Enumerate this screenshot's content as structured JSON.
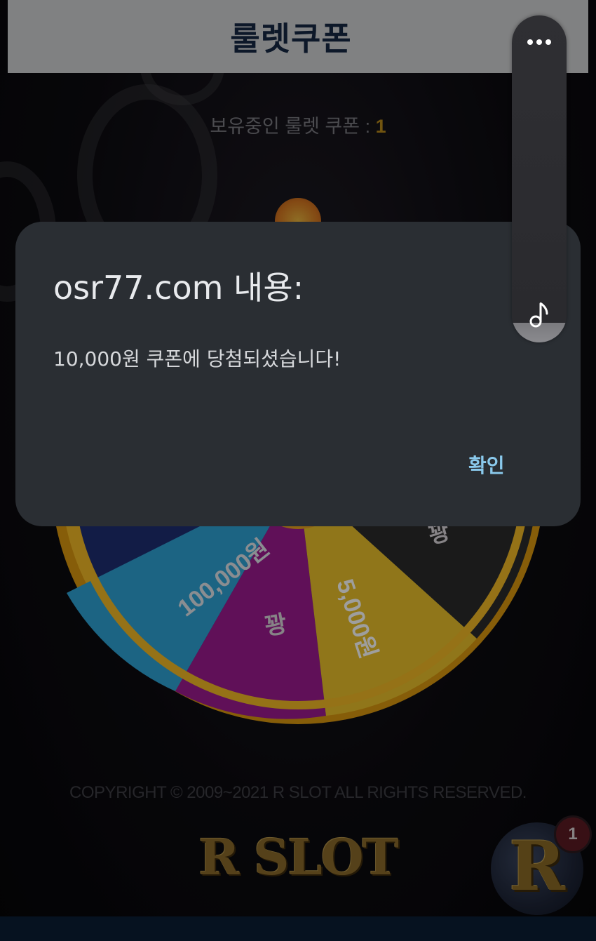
{
  "header": {
    "title": "룰렛쿠폰"
  },
  "coupon": {
    "label": "보유중인 룰렛 쿠폰 : ",
    "count": "1"
  },
  "wheel": {
    "segments": [
      {
        "label": "100,000원",
        "color": "#2ea2d3"
      },
      {
        "label": "꽝",
        "color": "#9c1a8e"
      },
      {
        "label": "5,000원",
        "color": "#e8bf2a"
      },
      {
        "label": "꽝",
        "color": "#2b2b2b"
      }
    ],
    "rim_color": "#e2a317"
  },
  "footer": {
    "copyright": "COPYRIGHT © 2009~2021 R SLOT ALL RIGHTS RESERVED.",
    "brand": "R SLOT"
  },
  "fab": {
    "letter": "R",
    "badge": "1"
  },
  "dialog": {
    "title": "osr77.com 내용:",
    "message": "10,000원 쿠폰에 당첨되셨습니다!",
    "ok_label": "확인"
  },
  "side_panel": {
    "more_icon": "more-horizontal-icon",
    "music_icon": "music-note-icon"
  }
}
